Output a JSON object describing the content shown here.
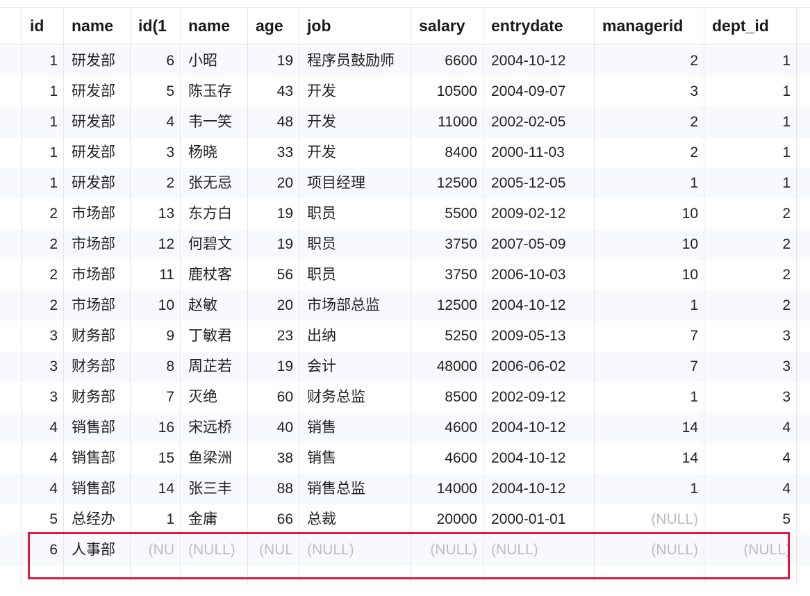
{
  "columns": [
    "id",
    "name",
    "id(1",
    "name",
    "age",
    "job",
    "salary",
    "entrydate",
    "managerid",
    "dept_id"
  ],
  "rows": [
    [
      "1",
      "研发部",
      "6",
      "小昭",
      "19",
      "程序员鼓励师",
      "6600",
      "2004-10-12",
      "2",
      "1"
    ],
    [
      "1",
      "研发部",
      "5",
      "陈玉存",
      "43",
      "开发",
      "10500",
      "2004-09-07",
      "3",
      "1"
    ],
    [
      "1",
      "研发部",
      "4",
      "韦一笑",
      "48",
      "开发",
      "11000",
      "2002-02-05",
      "2",
      "1"
    ],
    [
      "1",
      "研发部",
      "3",
      "杨晓",
      "33",
      "开发",
      "8400",
      "2000-11-03",
      "2",
      "1"
    ],
    [
      "1",
      "研发部",
      "2",
      "张无忌",
      "20",
      "项目经理",
      "12500",
      "2005-12-05",
      "1",
      "1"
    ],
    [
      "2",
      "市场部",
      "13",
      "东方白",
      "19",
      "职员",
      "5500",
      "2009-02-12",
      "10",
      "2"
    ],
    [
      "2",
      "市场部",
      "12",
      "何碧文",
      "19",
      "职员",
      "3750",
      "2007-05-09",
      "10",
      "2"
    ],
    [
      "2",
      "市场部",
      "11",
      "鹿杖客",
      "56",
      "职员",
      "3750",
      "2006-10-03",
      "10",
      "2"
    ],
    [
      "2",
      "市场部",
      "10",
      "赵敏",
      "20",
      "市场部总监",
      "12500",
      "2004-10-12",
      "1",
      "2"
    ],
    [
      "3",
      "财务部",
      "9",
      "丁敏君",
      "23",
      "出纳",
      "5250",
      "2009-05-13",
      "7",
      "3"
    ],
    [
      "3",
      "财务部",
      "8",
      "周芷若",
      "19",
      "会计",
      "48000",
      "2006-06-02",
      "7",
      "3"
    ],
    [
      "3",
      "财务部",
      "7",
      "灭绝",
      "60",
      "财务总监",
      "8500",
      "2002-09-12",
      "1",
      "3"
    ],
    [
      "4",
      "销售部",
      "16",
      "宋远桥",
      "40",
      "销售",
      "4600",
      "2004-10-12",
      "14",
      "4"
    ],
    [
      "4",
      "销售部",
      "15",
      "鱼梁洲",
      "38",
      "销售",
      "4600",
      "2004-10-12",
      "14",
      "4"
    ],
    [
      "4",
      "销售部",
      "14",
      "张三丰",
      "88",
      "销售总监",
      "14000",
      "2004-10-12",
      "1",
      "4"
    ],
    [
      "5",
      "总经办",
      "1",
      "金庸",
      "66",
      "总裁",
      "20000",
      "2000-01-01",
      "(NULL)",
      "5"
    ],
    [
      "6",
      "人事部",
      "(NU",
      "(NULL)",
      "(NUL",
      "(NULL)",
      "(NULL)",
      "(NULL)",
      "(NULL)",
      "(NULL)"
    ]
  ],
  "null_text": "(NULL)",
  "highlight_color": "#e0193f"
}
